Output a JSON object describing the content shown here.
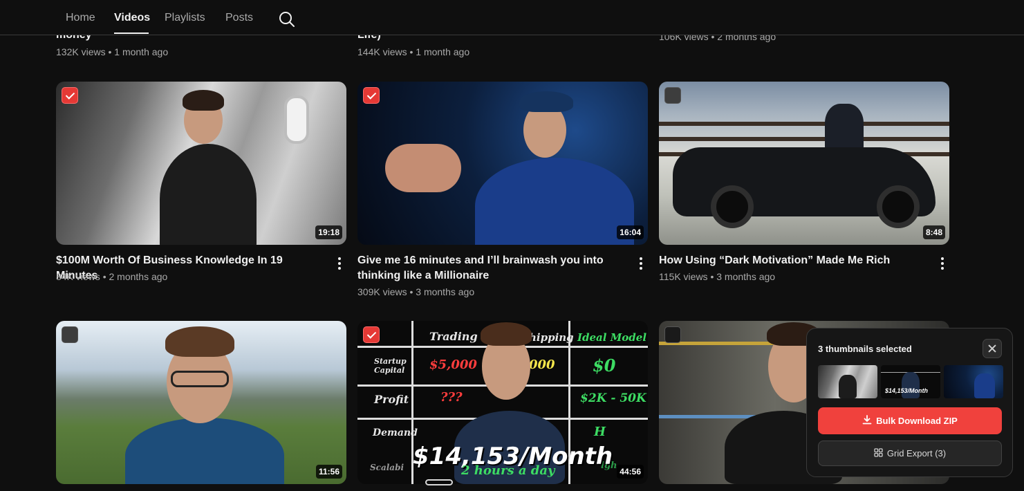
{
  "nav": {
    "tabs": [
      {
        "label": "Home",
        "active": false
      },
      {
        "label": "Videos",
        "active": true
      },
      {
        "label": "Playlists",
        "active": false
      },
      {
        "label": "Posts",
        "active": false
      }
    ],
    "search_icon": "search-icon"
  },
  "partial_row": [
    {
      "title_fragment": "money",
      "meta": "132K views • 1 month ago"
    },
    {
      "title_fragment": "Life)",
      "meta": "144K views • 1 month ago"
    },
    {
      "title_fragment": "",
      "meta": "106K views • 2 months ago"
    }
  ],
  "videos": [
    {
      "title": "$100M Worth Of Business Knowledge In 19 Minutes",
      "meta": "84K views • 2 months ago",
      "duration": "19:18",
      "selected": true
    },
    {
      "title": "Give me 16 minutes and I’ll brainwash you into thinking like a Millionaire",
      "meta": "309K views • 3 months ago",
      "duration": "16:04",
      "selected": true
    },
    {
      "title": "How Using “Dark Motivation” Made Me Rich",
      "meta": "115K views • 3 months ago",
      "duration": "8:48",
      "selected": false
    },
    {
      "duration": "11:56",
      "selected": false
    },
    {
      "duration": "44:56",
      "selected": true
    },
    {
      "selected": false
    }
  ],
  "thumb_text": {
    "board": {
      "col1": "Trading",
      "col2": "hipping",
      "col3": "Ideal Model",
      "row1": "Startup Capital",
      "row1_a": "$5,000",
      "row1_b": "000",
      "row1_c": "$0",
      "row2": "Profit",
      "row2_a": "???",
      "row2_c": "$2K - 50K",
      "row3": "Demand",
      "row3_c": "H",
      "row4": "Scalabi",
      "row4_c": "igh",
      "headline": "$14,153/Month",
      "subline": "2 hours a day"
    }
  },
  "bulk_panel": {
    "title": "3 thumbnails selected",
    "primary_label": "Bulk Download ZIP",
    "secondary_label": "Grid Export (3)",
    "mini_caption": "$14,153/Month",
    "download_icon": "download-icon",
    "grid_icon": "grid-icon",
    "close_icon": "close-icon"
  },
  "colors": {
    "accent": "#f0413d",
    "checkbox_checked": "#e53935",
    "background": "#0f0f0f"
  }
}
